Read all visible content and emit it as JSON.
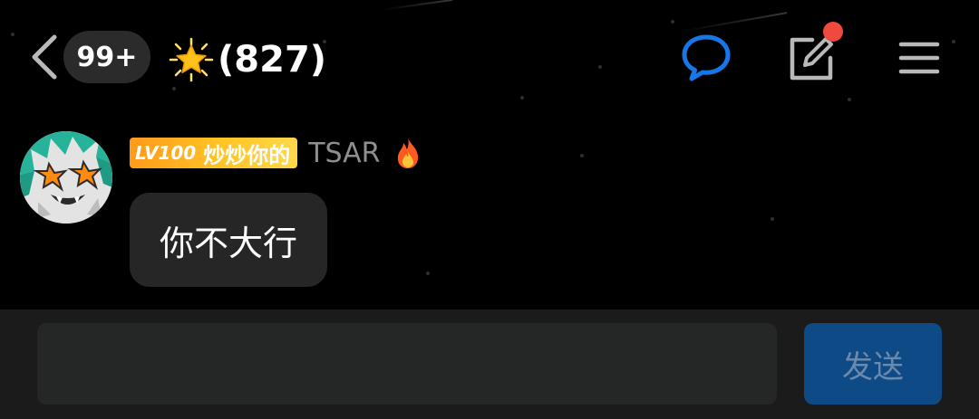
{
  "header": {
    "back_icon": "chevron-left-icon",
    "unread_count": "99+",
    "title_icon": "glowing-star-emoji",
    "title": "(827)",
    "actions": [
      {
        "name": "chat-bubble-icon",
        "color": "#1677e8"
      },
      {
        "name": "edit-icon",
        "has_notification_dot": true,
        "dot_color": "#f0493e"
      },
      {
        "name": "menu-icon"
      }
    ]
  },
  "message": {
    "avatar": "avatar",
    "level": "LV100",
    "nickname": "炒炒你的",
    "user_title": "TSAR",
    "badge_icon": "fire-emoji",
    "text": "你不大行"
  },
  "composer": {
    "input_value": "",
    "input_placeholder": "",
    "send_label": "发送"
  },
  "colors": {
    "background": "#000000",
    "bubble": "#262626",
    "level_tag": "#ffb020",
    "send_button": "#0d4a86",
    "send_text": "#6b89ad",
    "accent_blue": "#1677e8",
    "notification_dot": "#f0493e"
  }
}
